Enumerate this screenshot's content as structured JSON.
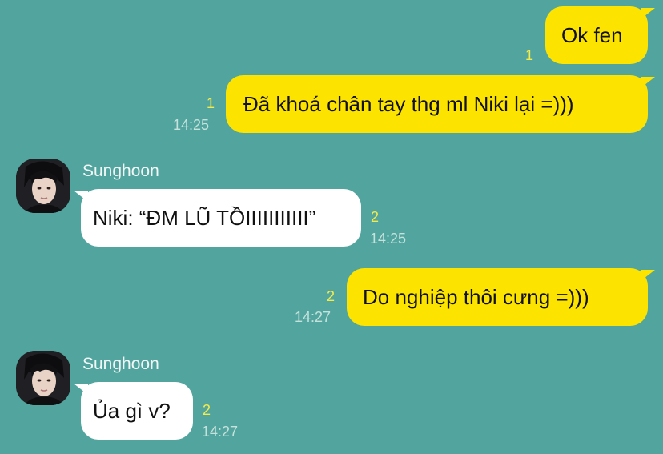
{
  "theme": {
    "background": "#52a59e",
    "outgoing_bubble": "#fde400",
    "incoming_bubble": "#ffffff",
    "read_count_color": "#f4ea4a",
    "time_color": "#c7e1dc"
  },
  "messages": [
    {
      "direction": "out",
      "text": "Ok fen",
      "unread": "1",
      "time": ""
    },
    {
      "direction": "out",
      "text": "Đã khoá chân tay thg ml Niki lại =)))",
      "unread": "1",
      "time": "14:25"
    },
    {
      "direction": "in",
      "sender": "Sunghoon",
      "avatar_icon": "profile-photo",
      "text": "Niki: “ĐM LŨ TỒIIIIIIIIIII”",
      "unread": "2",
      "time": "14:25"
    },
    {
      "direction": "out",
      "text": "Do nghiệp thôi cưng =)))",
      "unread": "2",
      "time": "14:27"
    },
    {
      "direction": "in",
      "sender": "Sunghoon",
      "avatar_icon": "profile-photo",
      "text": "Ủa gì v?",
      "unread": "2",
      "time": "14:27"
    }
  ]
}
